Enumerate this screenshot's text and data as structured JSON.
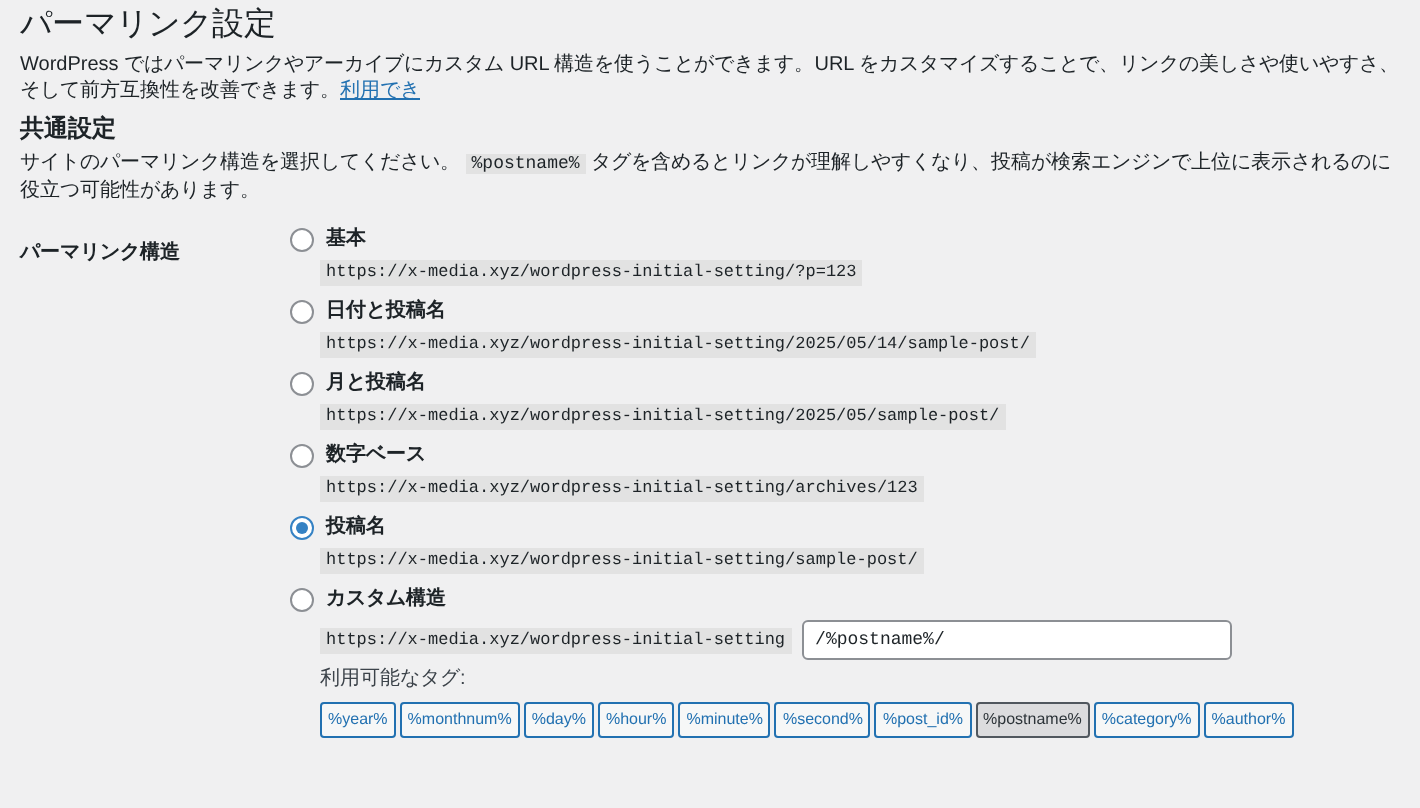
{
  "title": "パーマリンク設定",
  "intro": {
    "text": "WordPress ではパーマリンクやアーカイブにカスタム URL 構造を使うことができます。URL をカスタマイズすることで、リンクの美しさや使いやすさ、そして前方互換性を改善できます。",
    "link": "利用でき"
  },
  "section_title": "共通設定",
  "description": {
    "before": "サイトのパーマリンク構造を選択してください。",
    "code": "%postname%",
    "after": "タグを含めるとリンクが理解しやすくなり、投稿が検索エンジンで上位に表示されるのに役立つ可能性があります。"
  },
  "field_label": "パーマリンク構造",
  "options": [
    {
      "label": "基本",
      "example": "https://x-media.xyz/wordpress-initial-setting/?p=123",
      "selected": false
    },
    {
      "label": "日付と投稿名",
      "example": "https://x-media.xyz/wordpress-initial-setting/2025/05/14/sample-post/",
      "selected": false
    },
    {
      "label": "月と投稿名",
      "example": "https://x-media.xyz/wordpress-initial-setting/2025/05/sample-post/",
      "selected": false
    },
    {
      "label": "数字ベース",
      "example": "https://x-media.xyz/wordpress-initial-setting/archives/123",
      "selected": false
    },
    {
      "label": "投稿名",
      "example": "https://x-media.xyz/wordpress-initial-setting/sample-post/",
      "selected": true
    },
    {
      "label": "カスタム構造",
      "example": "https://x-media.xyz/wordpress-initial-setting",
      "selected": false
    }
  ],
  "custom_structure": {
    "value": "/%postname%/"
  },
  "tags_label": "利用可能なタグ:",
  "tags": [
    {
      "label": "%year%",
      "selected": false
    },
    {
      "label": "%monthnum%",
      "selected": false
    },
    {
      "label": "%day%",
      "selected": false
    },
    {
      "label": "%hour%",
      "selected": false
    },
    {
      "label": "%minute%",
      "selected": false
    },
    {
      "label": "%second%",
      "selected": false
    },
    {
      "label": "%post_id%",
      "selected": false
    },
    {
      "label": "%postname%",
      "selected": true
    },
    {
      "label": "%category%",
      "selected": false
    },
    {
      "label": "%author%",
      "selected": false
    }
  ]
}
